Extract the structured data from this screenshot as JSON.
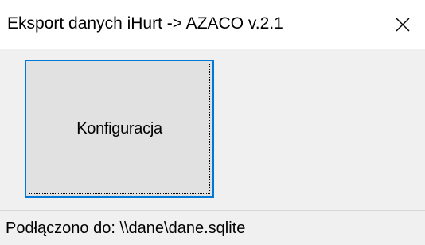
{
  "window": {
    "title": "Eksport danych iHurt -> AZACO v.2.1",
    "close_icon": "close-icon"
  },
  "main": {
    "config_button_label": "Konfiguracja"
  },
  "statusbar": {
    "text": "Podłączono do: \\\\dane\\dane.sqlite"
  },
  "colors": {
    "titlebar_bg": "#ffffff",
    "window_bg": "#f0f0f0",
    "button_bg": "#e1e1e1",
    "focus_border": "#0078d7"
  }
}
